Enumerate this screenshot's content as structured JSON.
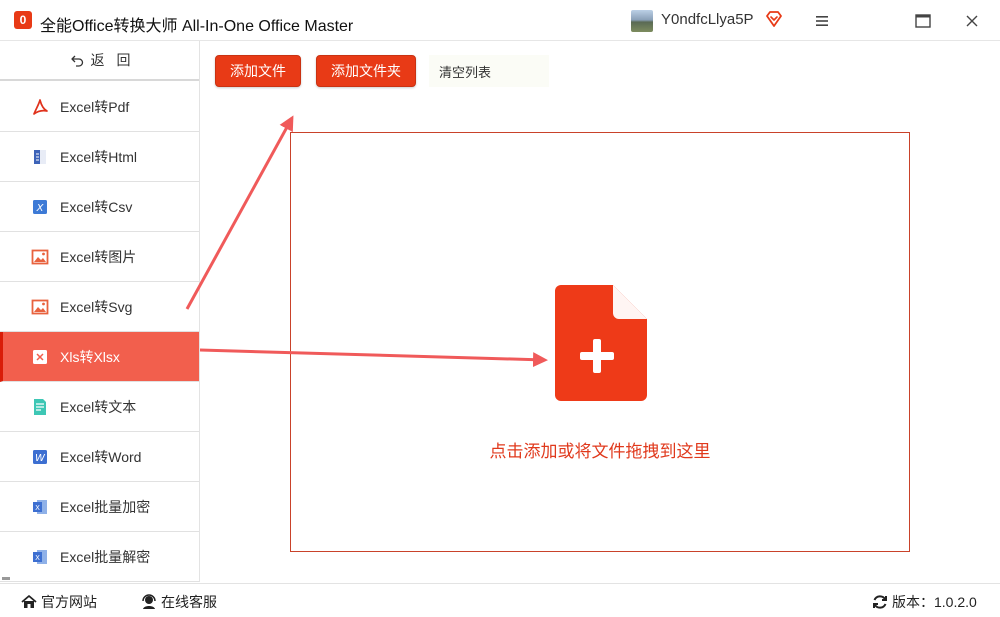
{
  "window": {
    "title": "全能Office转换大师 All-In-One Office Master",
    "logo_text": "0",
    "username": "Y0ndfcLlya5P"
  },
  "sidebar": {
    "back_label": "返回",
    "items": [
      {
        "label": "Excel转Pdf",
        "icon": "pdf-icon",
        "active": false
      },
      {
        "label": "Excel转Html",
        "icon": "html-icon",
        "active": false
      },
      {
        "label": "Excel转Csv",
        "icon": "csv-icon",
        "active": false
      },
      {
        "label": "Excel转图片",
        "icon": "image-icon",
        "active": false
      },
      {
        "label": "Excel转Svg",
        "icon": "svg-image-icon",
        "active": false
      },
      {
        "label": "Xls转Xlsx",
        "icon": "xlsx-icon",
        "active": true
      },
      {
        "label": "Excel转文本",
        "icon": "text-icon",
        "active": false
      },
      {
        "label": "Excel转Word",
        "icon": "word-icon",
        "active": false
      },
      {
        "label": "Excel批量加密",
        "icon": "excel-lock-icon",
        "active": false
      },
      {
        "label": "Excel批量解密",
        "icon": "excel-unlock-icon",
        "active": false
      }
    ]
  },
  "toolbar": {
    "add_file": "添加文件",
    "add_folder": "添加文件夹",
    "clear_list": "清空列表"
  },
  "dropzone": {
    "hint": "点击添加或将文件拖拽到这里"
  },
  "footer": {
    "website": "官方网站",
    "service": "在线客服",
    "version": "版本：1.0.2.0"
  },
  "colors": {
    "accent": "#e83a16",
    "active_item": "#f25f4d",
    "arrow": "#f05a5a"
  }
}
